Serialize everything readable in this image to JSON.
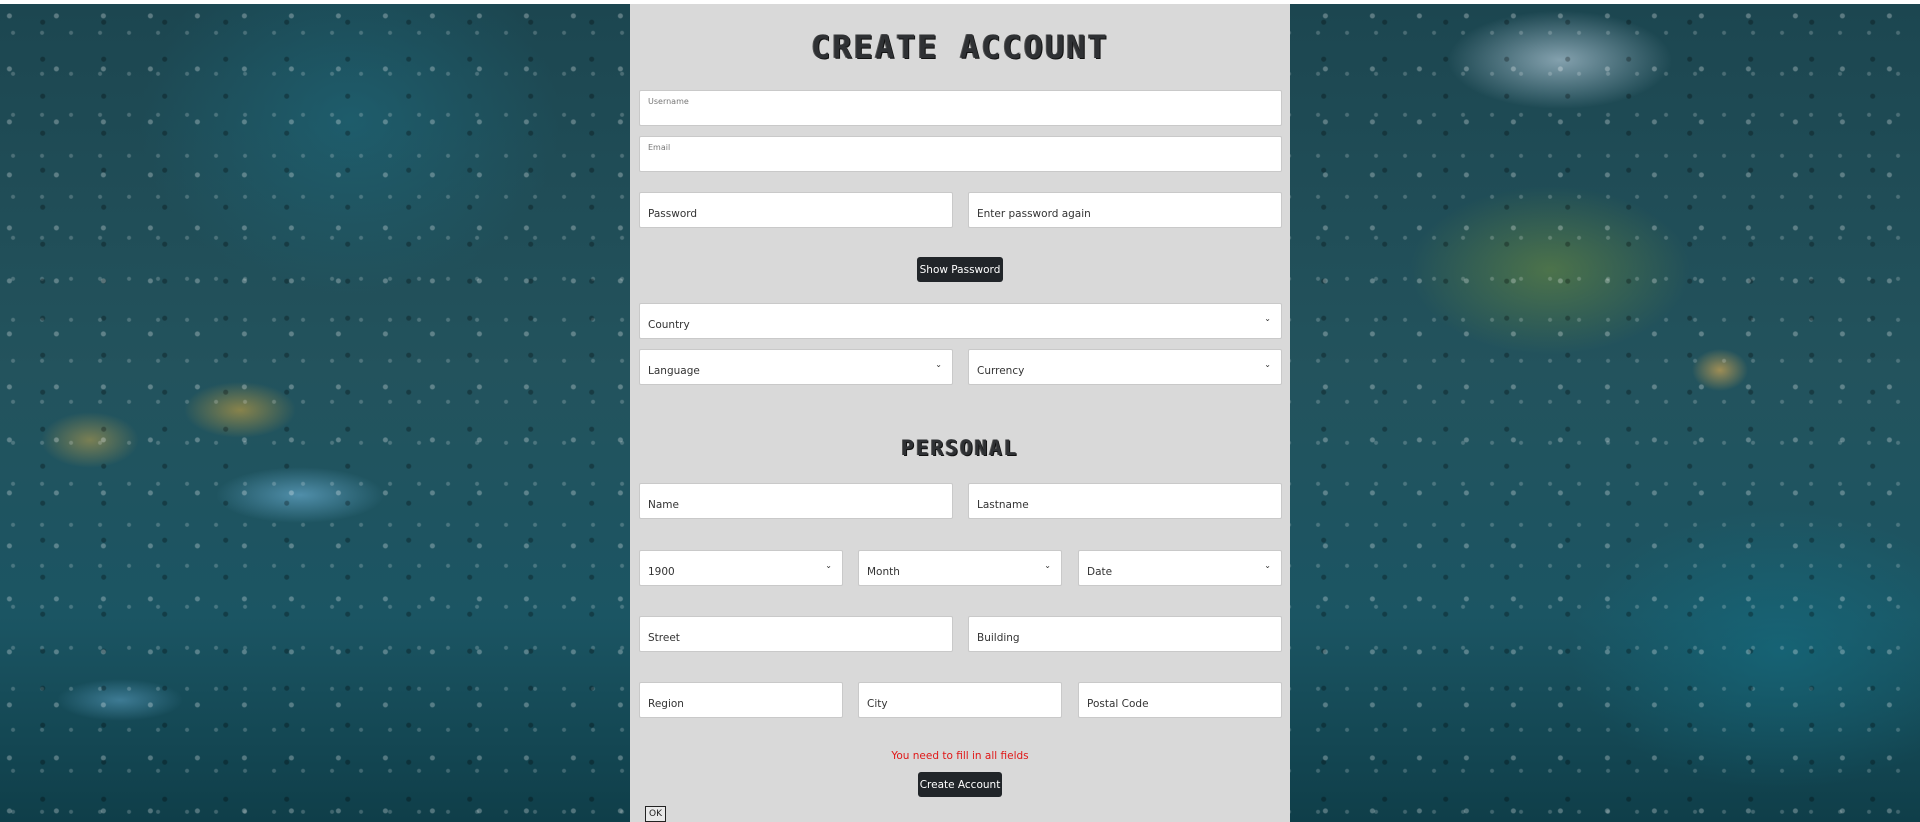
{
  "form": {
    "title": "CREATE ACCOUNT",
    "username_placeholder": "Username",
    "email_placeholder": "Email",
    "password_placeholder": "Password",
    "password_again_placeholder": "Enter password again",
    "show_password_label": "Show Password",
    "country_value": "Country",
    "language_value": "Language",
    "currency_value": "Currency"
  },
  "personal": {
    "title": "PERSONAL",
    "name_placeholder": "Name",
    "lastname_placeholder": "Lastname",
    "year_value": "1900",
    "month_value": "Month",
    "date_value": "Date",
    "street_placeholder": "Street",
    "building_placeholder": "Building",
    "region_placeholder": "Region",
    "city_placeholder": "City",
    "postal_code_placeholder": "Postal Code"
  },
  "footer": {
    "error_message": "You need to fill in all fields",
    "create_account_label": "Create Account",
    "ok_label": "OK"
  },
  "colors": {
    "panel": "#d9d9d9",
    "button": "#212529",
    "error": "#e01818"
  }
}
